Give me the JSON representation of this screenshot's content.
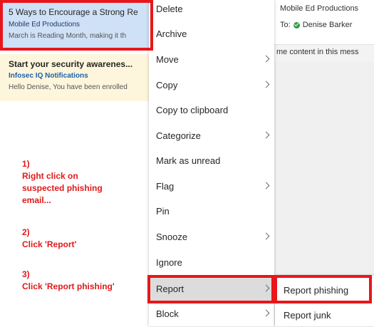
{
  "reading_pane": {
    "from": "Mobile Ed Productions",
    "to_label": "To:",
    "to_name": "Denise Barker",
    "info_text": "me content in this mess"
  },
  "messages": [
    {
      "subject": "5 Ways to Encourage a Strong Re",
      "sender": "Mobile Ed Productions",
      "preview": "March is Reading Month, making it th"
    },
    {
      "subject": "Start your security awarenes...",
      "sender": "Infosec IQ Notifications",
      "preview": "Hello Denise, You have been enrolled"
    }
  ],
  "instructions": {
    "step1_num": "1)",
    "step1_line1": "Right click on",
    "step1_line2": "suspected phishing",
    "step1_line3": "email...",
    "step2_num": "2)",
    "step2_text": "Click 'Report'",
    "step3_num": "3)",
    "step3_text": "Click 'Report phishing'",
    "color": "#e01919"
  },
  "context_menu": {
    "items": [
      {
        "label": "Delete",
        "has_submenu": false
      },
      {
        "label": "Archive",
        "has_submenu": false
      },
      {
        "label": "Move",
        "has_submenu": true
      },
      {
        "label": "Copy",
        "has_submenu": true
      },
      {
        "label": "Copy to clipboard",
        "has_submenu": false
      },
      {
        "label": "Categorize",
        "has_submenu": true
      },
      {
        "label": "Mark as unread",
        "has_submenu": false
      },
      {
        "label": "Flag",
        "has_submenu": true
      },
      {
        "label": "Pin",
        "has_submenu": false
      },
      {
        "label": "Snooze",
        "has_submenu": true
      },
      {
        "label": "Ignore",
        "has_submenu": false
      },
      {
        "label": "Report",
        "has_submenu": true,
        "active": true
      },
      {
        "label": "Block",
        "has_submenu": true
      }
    ]
  },
  "report_submenu": {
    "items": [
      {
        "label": "Report phishing"
      },
      {
        "label": "Report junk"
      }
    ]
  },
  "colors": {
    "highlight": "#e8161b",
    "selected_message": "#cfe1f6",
    "unread_message": "#fdf6dc",
    "status_available": "#2e9e44"
  }
}
